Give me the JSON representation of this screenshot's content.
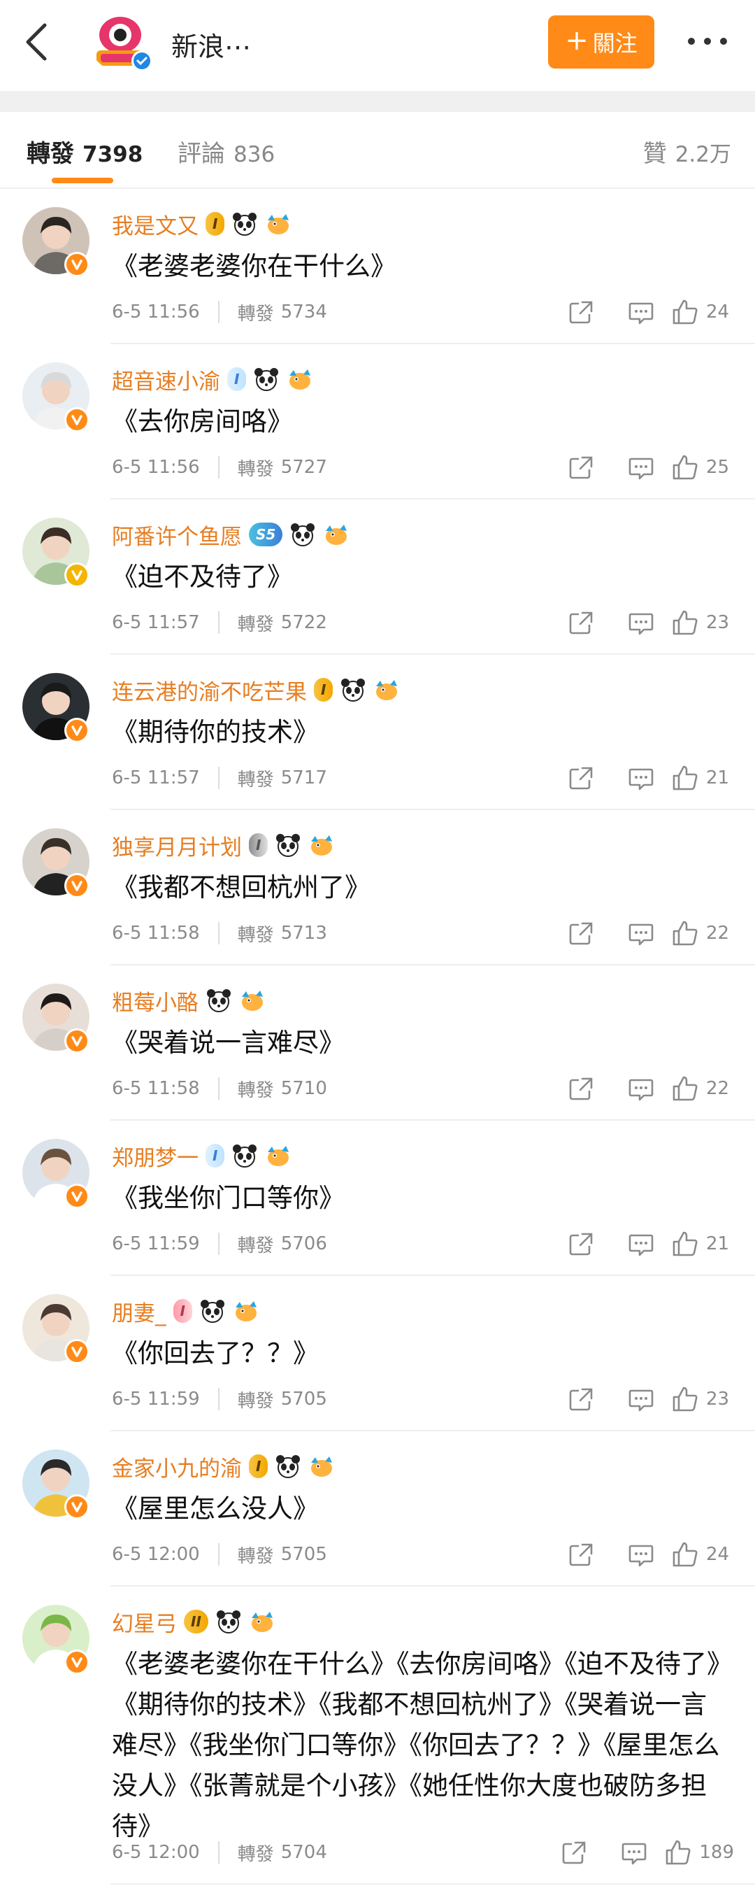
{
  "header": {
    "title": "新浪⋯",
    "follow_label": "關注",
    "follow_plus": "+"
  },
  "tabs": {
    "repost": {
      "label": "轉發",
      "count": "7398"
    },
    "comments": {
      "label": "評論",
      "count": "836"
    },
    "likes": {
      "label": "贊",
      "count": "2.2万"
    }
  },
  "colors": {
    "accent": "#ff8a17",
    "username": "#e67e22",
    "meta": "#8a8a8a"
  },
  "repost_label": "轉發",
  "rows": [
    {
      "name": "我是文又",
      "level": "I",
      "level_style": "gold",
      "text": "《老婆老婆你在干什么》",
      "time": "6-5 11:56",
      "reposts": "5734",
      "likes": "24"
    },
    {
      "name": "超音速小渝",
      "level": "I",
      "level_style": "blue",
      "text": "《去你房间咯》",
      "time": "6-5 11:56",
      "reposts": "5727",
      "likes": "25"
    },
    {
      "name": "阿番许个鱼愿",
      "level": "S5",
      "level_style": "teal",
      "text": "《迫不及待了》",
      "time": "6-5 11:57",
      "reposts": "5722",
      "likes": "23"
    },
    {
      "name": "连云港的渝不吃芒果",
      "level": "I",
      "level_style": "gold",
      "text": "《期待你的技术》",
      "time": "6-5 11:57",
      "reposts": "5717",
      "likes": "21"
    },
    {
      "name": "独享月月计划",
      "level": "I",
      "level_style": "gray",
      "text": "《我都不想回杭州了》",
      "time": "6-5 11:58",
      "reposts": "5713",
      "likes": "22"
    },
    {
      "name": "粗莓小酪",
      "level": "",
      "level_style": "none",
      "text": "《哭着说一言难尽》",
      "time": "6-5 11:58",
      "reposts": "5710",
      "likes": "22"
    },
    {
      "name": "郑朋梦一",
      "level": "I",
      "level_style": "blue",
      "text": "《我坐你门口等你》",
      "time": "6-5 11:59",
      "reposts": "5706",
      "likes": "21"
    },
    {
      "name": "朋妻_",
      "level": "I",
      "level_style": "pink",
      "text": "《你回去了？？》",
      "time": "6-5 11:59",
      "reposts": "5705",
      "likes": "23"
    },
    {
      "name": "金家小九的渝",
      "level": "I",
      "level_style": "gold",
      "text": "《屋里怎么没人》",
      "time": "6-5 12:00",
      "reposts": "5705",
      "likes": "24"
    },
    {
      "name": "幻星弓",
      "level": "II",
      "level_style": "gold",
      "text": "《老婆老婆你在干什么》《去你房间咯》《迫不及待了》《期待你的技术》《我都不想回杭州了》《哭着说一言难尽》《我坐你门口等你》《你回去了？？》《屋里怎么没人》《张菁就是个小孩》《她任性你大度也破防多担待》",
      "time": "6-5 12:00",
      "reposts": "5704",
      "likes": "189"
    }
  ]
}
